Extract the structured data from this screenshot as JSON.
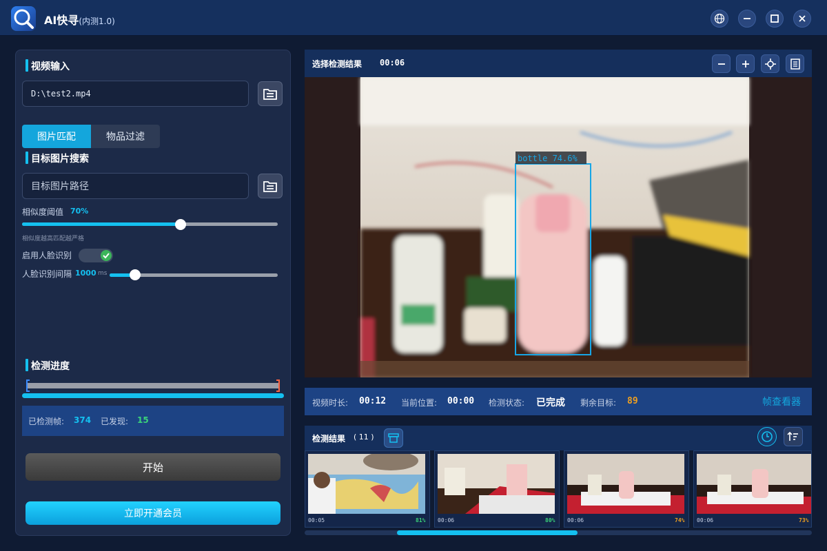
{
  "app": {
    "title": "AI快寻",
    "subtitle": "(内测1.0)"
  },
  "window_controls": [
    "globe-icon",
    "minimize-icon",
    "maximize-icon",
    "close-icon"
  ],
  "video_input": {
    "heading": "视频输入",
    "path": "D:\\test2.mp4"
  },
  "tabs": [
    {
      "label": "图片匹配",
      "active": true
    },
    {
      "label": "物品过滤",
      "active": false
    }
  ],
  "target_search": {
    "heading": "目标图片搜索",
    "path_placeholder": "目标图片路径",
    "threshold_label": "相似度阈值",
    "threshold_value": "70%",
    "threshold_level": 0.62,
    "threshold_hint": "相似度越高匹配越严格",
    "face_label": "启用人脸识别",
    "face_enabled": true,
    "interval_label": "人脸识别间隔",
    "interval_value": "1000",
    "interval_unit": "ms",
    "interval_level": 0.15
  },
  "progress": {
    "heading": "检测进度",
    "level": 1.0,
    "detected_frames_label": "已检测帧:",
    "detected_frames": "374",
    "found_label": "已发现:",
    "found": "15"
  },
  "buttons": {
    "start": "开始",
    "vip": "立即开通会员"
  },
  "viewer": {
    "title": "选择检测结果",
    "time": "00:06",
    "detection_label": "bottle 74.6%"
  },
  "status_bar": {
    "duration_label": "视频时长:",
    "duration": "00:12",
    "position_label": "当前位置:",
    "position": "00:00",
    "state_label": "检测状态:",
    "state": "已完成",
    "remaining_label": "剩余目标:",
    "remaining": "89",
    "frame_viewer": "帧查看器"
  },
  "results": {
    "title": "检测结果",
    "count": "( 11 )",
    "thumbnails": [
      {
        "time": "00:05",
        "score": "81%"
      },
      {
        "time": "00:06",
        "score": "80%"
      },
      {
        "time": "00:06",
        "score": "74%"
      },
      {
        "time": "00:06",
        "score": "73%"
      }
    ]
  },
  "colors": {
    "accent": "#14c0f0",
    "panel": "#1c2a48",
    "header": "#15305e",
    "green": "#3bd37a",
    "orange": "#f0a020"
  }
}
